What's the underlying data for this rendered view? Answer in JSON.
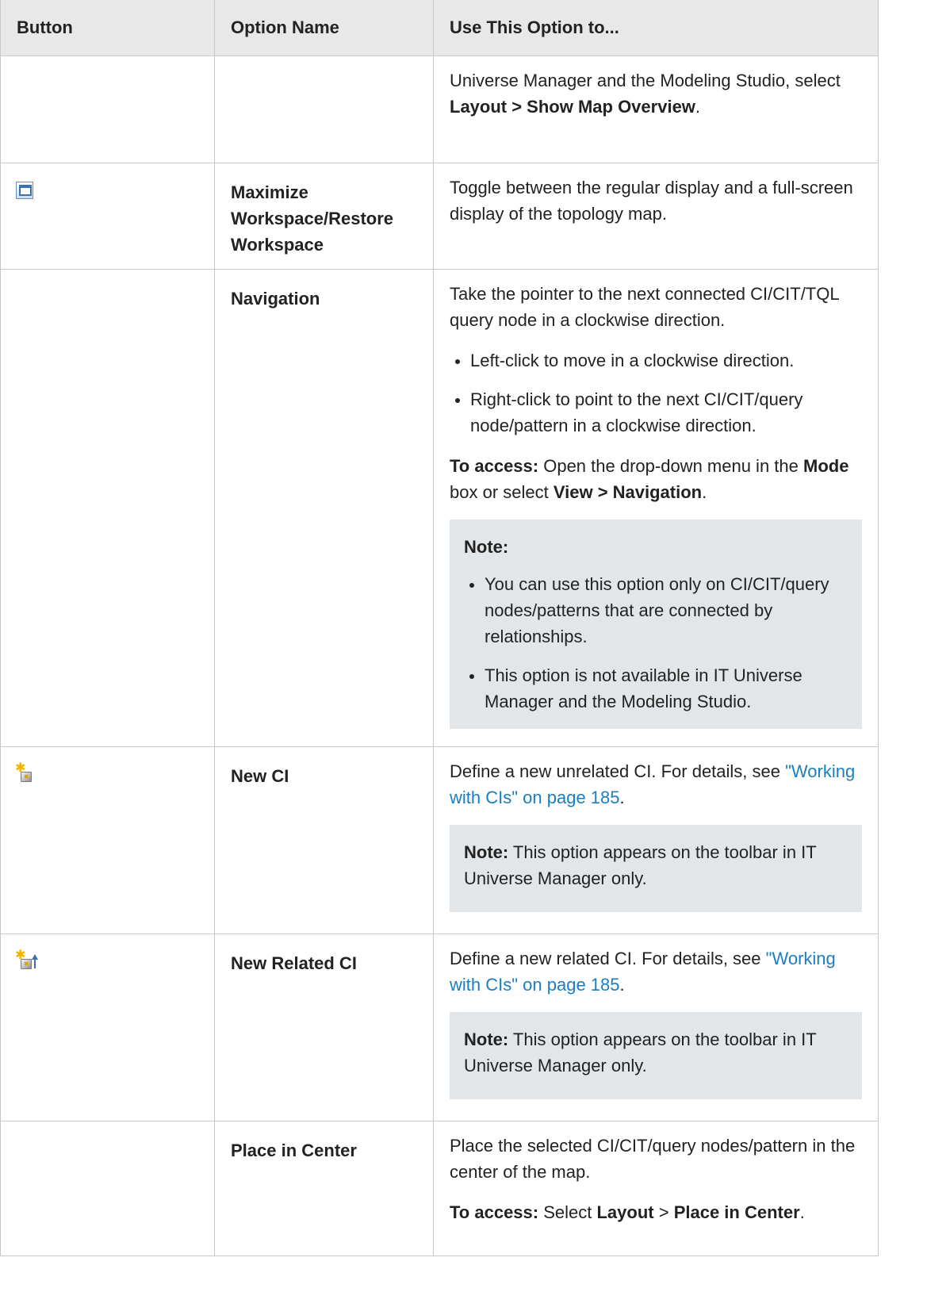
{
  "headers": {
    "button": "Button",
    "option_name": "Option Name",
    "use": "Use This Option to..."
  },
  "row0": {
    "text_a": "Universe Manager and the Modeling Studio, select ",
    "kw1": "Layout > Show Map Overview",
    "text_b": "."
  },
  "row1": {
    "icon": "maximize-workspace-icon",
    "name": "Maximize Workspace/Restore Workspace",
    "desc": "Toggle between the regular display and a full-screen display of the topology map."
  },
  "row2": {
    "name": "Navigation",
    "desc": "Take the pointer to the next connected CI/CIT/TQL query node in a clockwise direction.",
    "bullet1": "Left-click to move in a clockwise direction.",
    "bullet2": "Right-click to point to the next CI/CIT/query node/pattern in a clockwise direction.",
    "access_label": "To access:",
    "access_a": " Open the drop-down menu in the ",
    "access_kw1": "Mode",
    "access_b": " box or select ",
    "access_kw2": "View > Navigation",
    "access_c": ".",
    "note_label": "Note:",
    "note_bullet1": "You can use this option only on CI/CIT/query nodes/patterns that are connected by relationships.",
    "note_bullet2": "This option is not available in IT Universe Manager and the Modeling Studio."
  },
  "row3": {
    "icon": "new-ci-icon",
    "name": "New CI",
    "desc_a": "Define a new unrelated CI. For details, see ",
    "link": "\"Working with CIs\" on page 185",
    "desc_b": ".",
    "note_label": "Note:",
    "note_text": " This option appears on the toolbar in IT Universe Manager only."
  },
  "row4": {
    "icon": "new-related-ci-icon",
    "name": "New Related CI",
    "desc_a": "Define a new related CI. For details, see ",
    "link": "\"Working with CIs\" on page 185",
    "desc_b": ".",
    "note_label": "Note:",
    "note_text": " This option appears on the toolbar in IT Universe Manager only."
  },
  "row5": {
    "name": "Place in Center",
    "desc": "Place the selected CI/CIT/query nodes/pattern in the center of the map.",
    "access_label": "To access:",
    "access_a": " Select ",
    "access_kw1": "Layout",
    "access_b": " > ",
    "access_kw2": "Place in Center",
    "access_c": "."
  },
  "colors": {
    "header_bg": "#e8e8e8",
    "note_bg": "#e3e6e8",
    "link": "#1a7ec2",
    "border": "#c8c8c8"
  }
}
